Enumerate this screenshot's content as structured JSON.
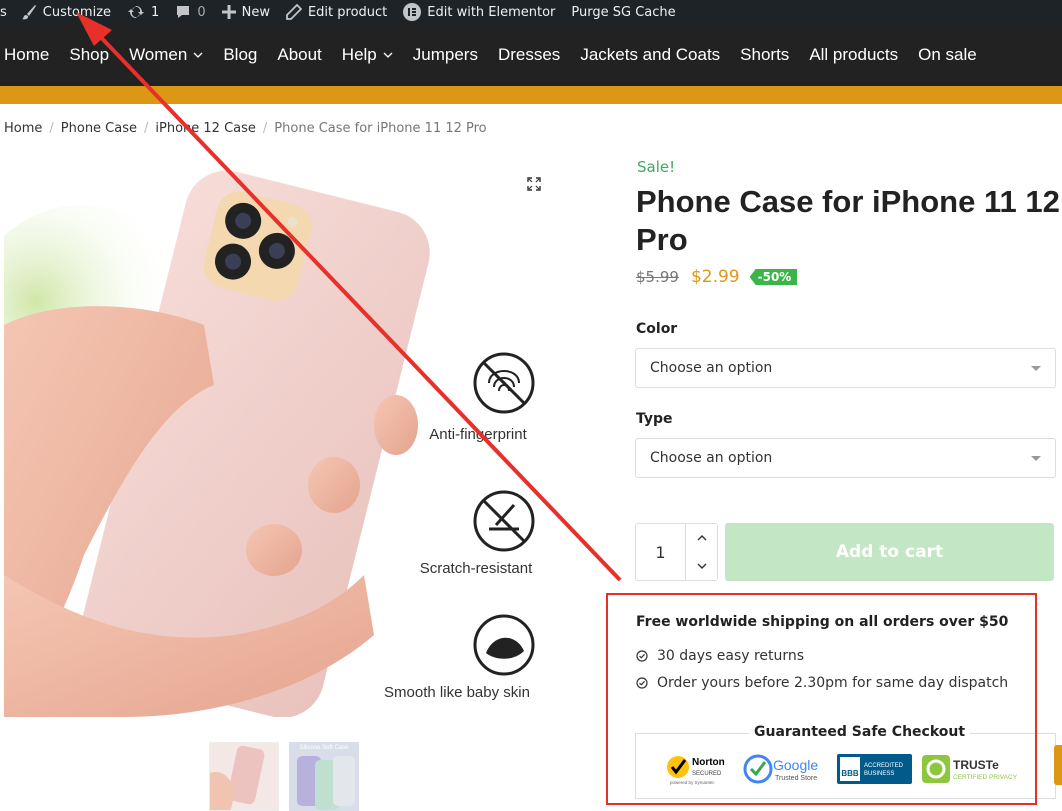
{
  "adminbar": {
    "partial": "s",
    "customize": "Customize",
    "updates_count": "1",
    "comments_count": "0",
    "new": "New",
    "edit_product": "Edit product",
    "edit_elementor": "Edit with Elementor",
    "purge": "Purge SG Cache"
  },
  "nav": {
    "items": [
      "Home",
      "Shop",
      "Women",
      "Blog",
      "About",
      "Help",
      "Jumpers",
      "Dresses",
      "Jackets and Coats",
      "Shorts",
      "All products",
      "On sale"
    ]
  },
  "breadcrumb": {
    "items": [
      "Home",
      "Phone Case",
      "iPhone 12 Case"
    ],
    "current": "Phone Case for iPhone 11 12 Pro"
  },
  "image_labels": {
    "anti": "Anti-fingerprint",
    "scratch": "Scratch-resistant",
    "smooth": "Smooth like baby skin",
    "thumb2": "Silicone Soft Case"
  },
  "product": {
    "sale": "Sale!",
    "title": "Phone Case for iPhone 11 12 Pro",
    "old_price": "$5.99",
    "new_price": "$2.99",
    "discount": "-50%"
  },
  "variations": {
    "color_label": "Color",
    "color_value": "Choose an option",
    "type_label": "Type",
    "type_value": "Choose an option"
  },
  "cart": {
    "quantity": "1",
    "add_to_cart": "Add to cart"
  },
  "info": {
    "shipping": "Free worldwide shipping on all orders over $50",
    "benefits": [
      "30 days easy returns",
      "Order yours before 2.30pm for same day dispatch"
    ],
    "checkout_title": "Guaranteed Safe Checkout"
  },
  "badges": {
    "norton": "Norton",
    "norton_sub": "SECURED",
    "norton_powered": "powered by Symantec",
    "google": "Google",
    "google_sub": "Trusted Store",
    "bbb_line1": "ACCREDITED",
    "bbb_line2": "BUSINESS",
    "truste": "TRUSTe",
    "truste_sub": "CERTIFIED PRIVACY"
  },
  "colors": {
    "accent": "#dc9814",
    "sale_green": "#41a85f",
    "nav_bg": "#222222",
    "annotation_red": "#e8302a"
  }
}
